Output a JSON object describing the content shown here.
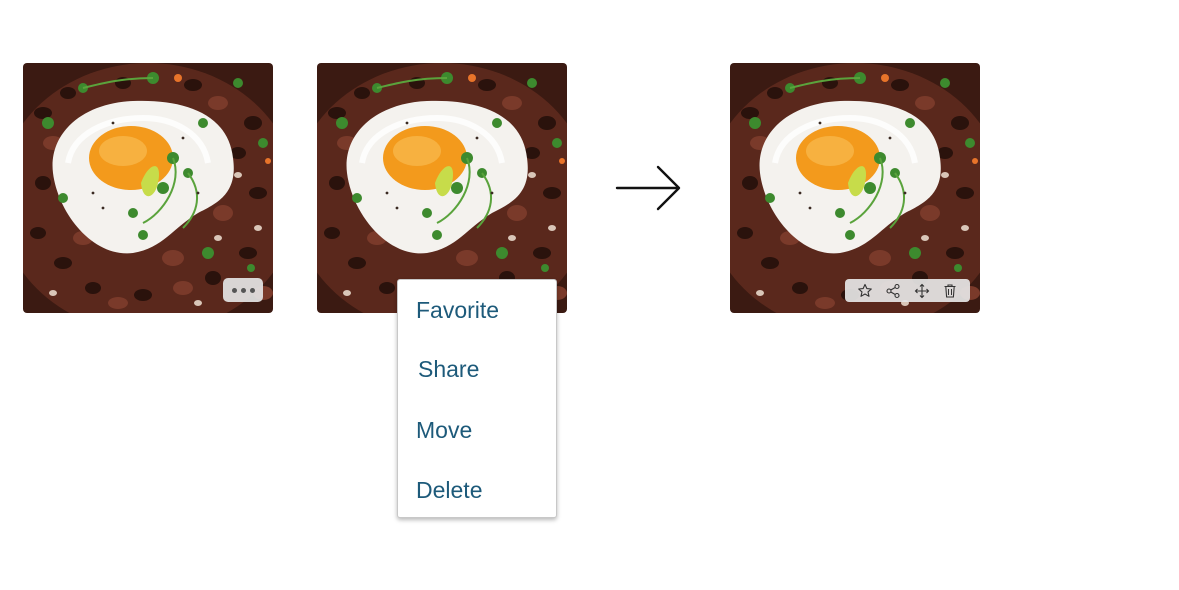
{
  "cards": [
    {
      "photo": "fried-egg-beans-photo",
      "control": "more-button",
      "control_icon": "ellipsis-icon"
    },
    {
      "photo": "fried-egg-beans-photo",
      "state": "menu-open"
    },
    {
      "photo": "fried-egg-beans-photo",
      "control": "action-bar"
    }
  ],
  "context_menu": {
    "items": [
      {
        "label": "Favorite"
      },
      {
        "label": "Share"
      },
      {
        "label": "Move"
      },
      {
        "label": "Delete"
      }
    ]
  },
  "action_bar": {
    "icons": [
      "star-icon",
      "share-icon",
      "move-icon",
      "trash-icon"
    ]
  },
  "transition_icon": "arrow-right-icon",
  "colors": {
    "menu_text": "#1d5a7a",
    "overlay": "#e4e4e4",
    "plate": "#4a1f16",
    "yolk": "#f39a1c",
    "herbs": "#3d8a2e"
  }
}
